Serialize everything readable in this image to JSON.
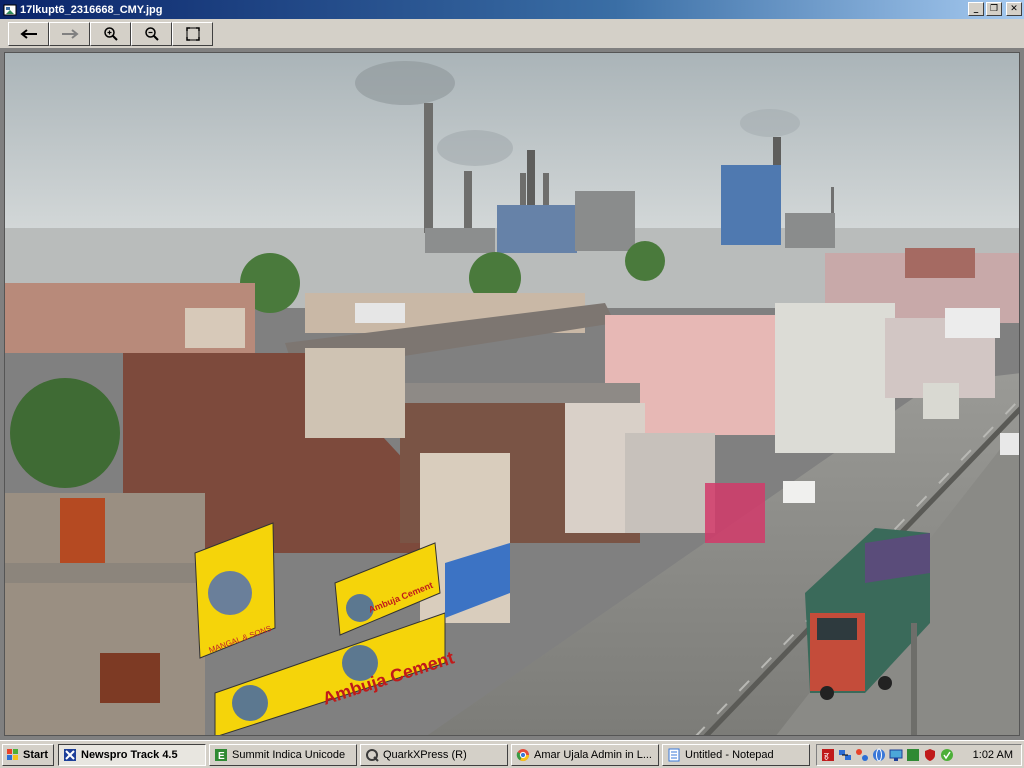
{
  "window": {
    "title": "17lkupt6_2316668_CMY.jpg",
    "controls": [
      "minimize",
      "restore",
      "close"
    ]
  },
  "toolbar": {
    "buttons": [
      {
        "icon": "arrow-left-icon",
        "action": "previous"
      },
      {
        "icon": "arrow-right-icon",
        "action": "next"
      },
      {
        "icon": "zoom-in-icon",
        "action": "zoom-in"
      },
      {
        "icon": "zoom-out-icon",
        "action": "zoom-out"
      },
      {
        "icon": "fit-screen-icon",
        "action": "fit"
      }
    ]
  },
  "photo": {
    "billboards": [
      {
        "text": "Ambuja Cement"
      },
      {
        "text": "Ambuja Cement"
      },
      {
        "text": "Ambuja Cement"
      }
    ],
    "shop_sign": "MANGAL & SONS"
  },
  "taskbar": {
    "start_label": "Start",
    "tasks": [
      {
        "label": "Newspro Track 4.5",
        "active": true,
        "icon": "newspro-icon"
      },
      {
        "label": "Summit Indica Unicode",
        "active": false,
        "icon": "summit-icon"
      },
      {
        "label": "QuarkXPress (R)",
        "active": false,
        "icon": "quark-icon"
      },
      {
        "label": "Amar Ujala Admin in L...",
        "active": false,
        "icon": "chrome-icon"
      },
      {
        "label": "Untitled - Notepad",
        "active": false,
        "icon": "notepad-icon"
      }
    ],
    "clock": "1:02 AM"
  },
  "colors": {
    "title_gradient_start": "#0a246a",
    "billboard_yellow": "#f5d40a",
    "sky": "#b8c0c4"
  }
}
